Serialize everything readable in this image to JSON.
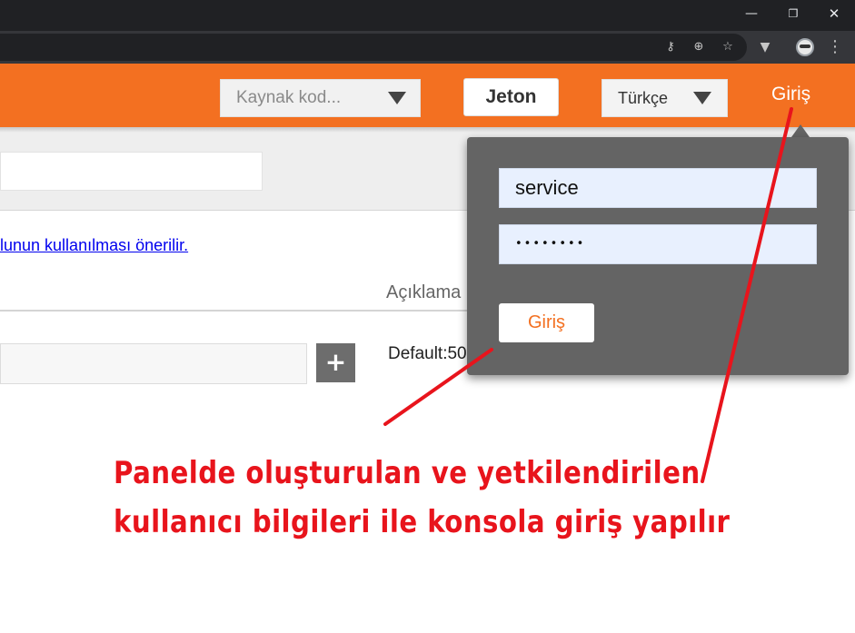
{
  "browser": {
    "window_controls": {
      "minimize_glyph": "—",
      "restore_glyph": "❐",
      "close_glyph": "✕"
    },
    "toolbar_icons": [
      "key-icon",
      "zoom-icon",
      "star-icon",
      "extension-v-icon",
      "profile-avatar",
      "menu-dots-icon"
    ],
    "glyphs": {
      "key": "⚷",
      "zoom": "⊕",
      "star": "☆",
      "ext": "▼",
      "menu": "⋮"
    }
  },
  "header": {
    "background_color": "#f37021",
    "source_select": {
      "placeholder": "Kaynak kod..."
    },
    "token_button": {
      "label": "Jeton"
    },
    "language_select": {
      "value": "Türkçe"
    },
    "login_link": {
      "label": "Giriş"
    }
  },
  "content": {
    "notice_link": "lunun kullanılması önerilir.",
    "column_header": "Açıklama",
    "plus_glyph": "+",
    "default_value_text": "Default:50"
  },
  "login_popover": {
    "username": "service",
    "password_masked": "••••••••",
    "submit_label": "Giriş"
  },
  "annotation": {
    "color": "#e8141c",
    "line1": "Panelde oluşturulan ve yetkilendirilen",
    "line2": "kullanıcı bilgileri ile konsola giriş yapılır"
  }
}
